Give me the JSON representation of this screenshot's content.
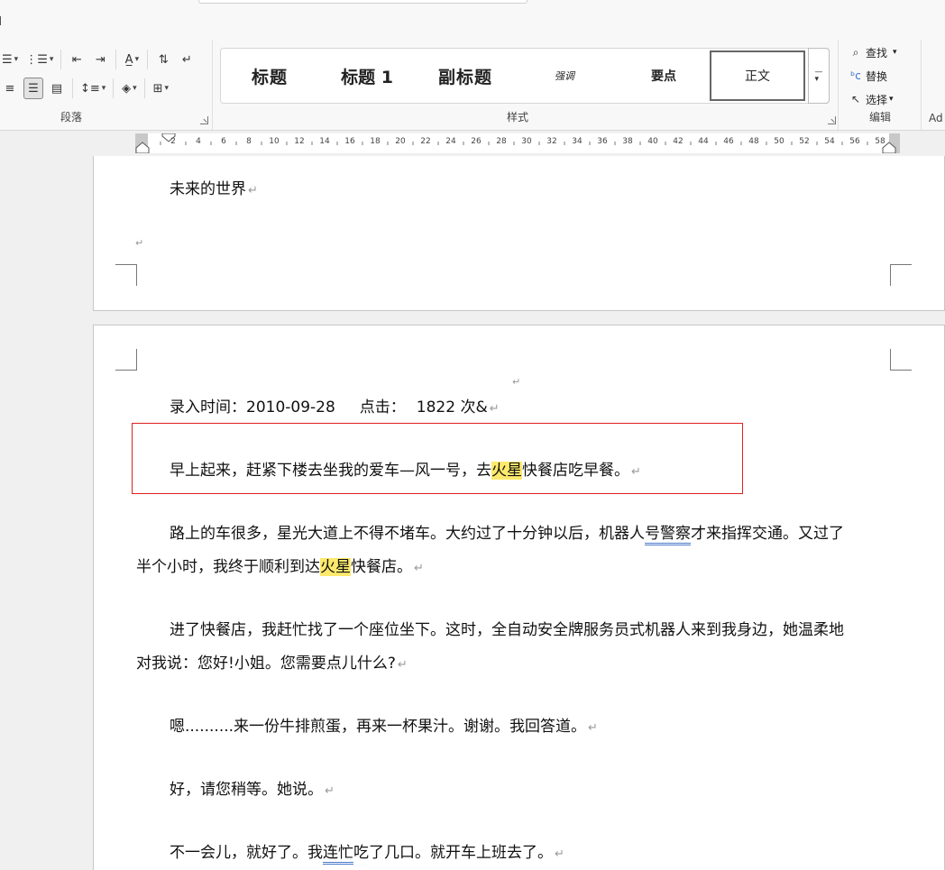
{
  "ribbon": {
    "paragraph_group_label": "段落",
    "styles_group_label": "样式",
    "editing_group_label": "编辑",
    "add_label": "Ad",
    "styles": [
      {
        "label": "标题"
      },
      {
        "label": "标题 1"
      },
      {
        "label": "副标题"
      },
      {
        "label": "强调"
      },
      {
        "label": "要点"
      },
      {
        "label": "正文"
      }
    ],
    "editing": {
      "find": "查找",
      "replace": "替换",
      "select": "选择"
    }
  },
  "ruler": {
    "ticks": [
      "2",
      "4",
      "6",
      "8",
      "10",
      "12",
      "14",
      "16",
      "18",
      "20",
      "22",
      "24",
      "26",
      "28",
      "30",
      "32",
      "34",
      "36",
      "38",
      "40",
      "42",
      "44",
      "46",
      "48",
      "50",
      "52",
      "54",
      "56",
      "58"
    ]
  },
  "document": {
    "page1": {
      "title_line": "未来的世界"
    },
    "page2": {
      "meta_line_prefix": "录入时间：2010-09-28",
      "meta_line_clicks_label": "点击：",
      "meta_line_clicks_value": "1822 次&",
      "p1_a": "早上起来，赶紧下楼去坐我的爱车—风一号，去",
      "p1_hl": "火星",
      "p1_b": "快餐店吃早餐。",
      "p2_l1_a": "路上的车很多，星光大道上不得不堵车。大约过了十分钟以后，机器人",
      "p2_l1_ul": "号警察",
      "p2_l1_b": "才来指挥交通。又过了",
      "p2_l2_a": "半个小时，我终于顺利到达",
      "p2_l2_hl": "火星",
      "p2_l2_b": "快餐店。",
      "p3_l1": "进了快餐店，我赶忙找了一个座位坐下。这时，全自动安全牌服务员式机器人来到我身边，她温柔地",
      "p3_l2": "对我说：您好!小姐。您需要点儿什么?",
      "p4": "嗯..........来一份牛排煎蛋，再来一杯果汁。谢谢。我回答道。",
      "p5": "好，请您稍等。她说。",
      "p6_a": "不一会儿，就好了。我",
      "p6_ul": "连忙",
      "p6_b": "吃了几口。就开车上班去了。"
    }
  },
  "colors": {
    "highlight": "#fde96c",
    "selection_border": "#e02020",
    "grammar_underline": "#4a78c8"
  }
}
